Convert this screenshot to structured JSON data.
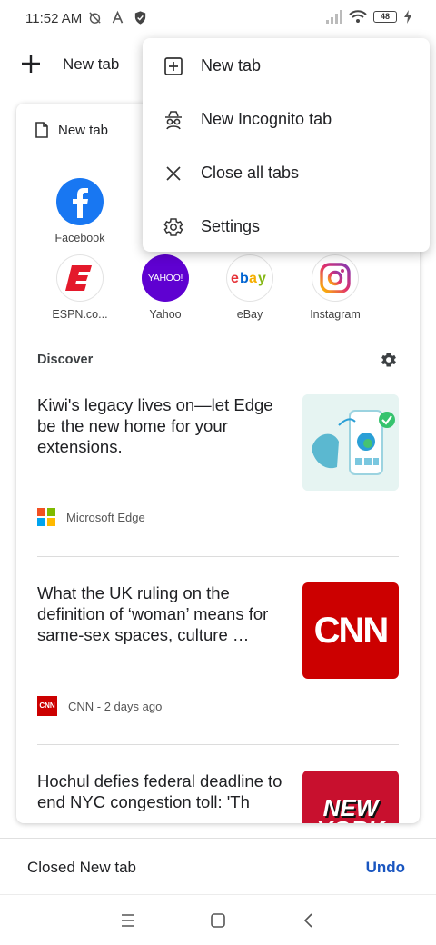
{
  "status_bar": {
    "time": "11:52 AM",
    "battery": "48",
    "icons": [
      "alarm-off-icon",
      "a-icon",
      "shield-icon",
      "signal-icon",
      "wifi-icon",
      "battery-icon",
      "charging-icon"
    ]
  },
  "top_bar": {
    "new_tab_label": "New tab",
    "icon": "plus-icon"
  },
  "card": {
    "title": "New tab",
    "sites": [
      {
        "label": "Facebook",
        "icon": "facebook-logo"
      },
      {
        "label": "ESPN.co...",
        "icon": "espn-logo"
      },
      {
        "label": "Yahoo",
        "icon": "yahoo-logo",
        "logo_text": "YAHOO!"
      },
      {
        "label": "eBay",
        "icon": "ebay-logo"
      },
      {
        "label": "Instagram",
        "icon": "instagram-logo"
      }
    ],
    "discover_label": "Discover",
    "articles": [
      {
        "title": "Kiwi's legacy lives on—let Edge be the new home for your extensions.",
        "source": "Microsoft Edge"
      },
      {
        "title": "What the UK ruling on the definition of ‘woman’ means for same-sex spaces, culture …",
        "source": "CNN - 2 days ago",
        "logo_text": "CNN"
      },
      {
        "title": "Hochul defies federal deadline to end NYC congestion toll: 'Th",
        "source": "",
        "logo_text": "NEW YORK"
      }
    ]
  },
  "menu": {
    "items": [
      {
        "label": "New tab",
        "icon": "plus-box-icon"
      },
      {
        "label": "New Incognito tab",
        "icon": "incognito-icon"
      },
      {
        "label": "Close all tabs",
        "icon": "close-icon"
      },
      {
        "label": "Settings",
        "icon": "gear-icon"
      }
    ]
  },
  "snackbar": {
    "text": "Closed New tab",
    "action": "Undo"
  },
  "colors": {
    "accent": "#1a56c0",
    "facebook": "#1877f2",
    "espn": "#e4192b",
    "yahoo": "#5f01d1",
    "cnn": "#cc0000"
  }
}
